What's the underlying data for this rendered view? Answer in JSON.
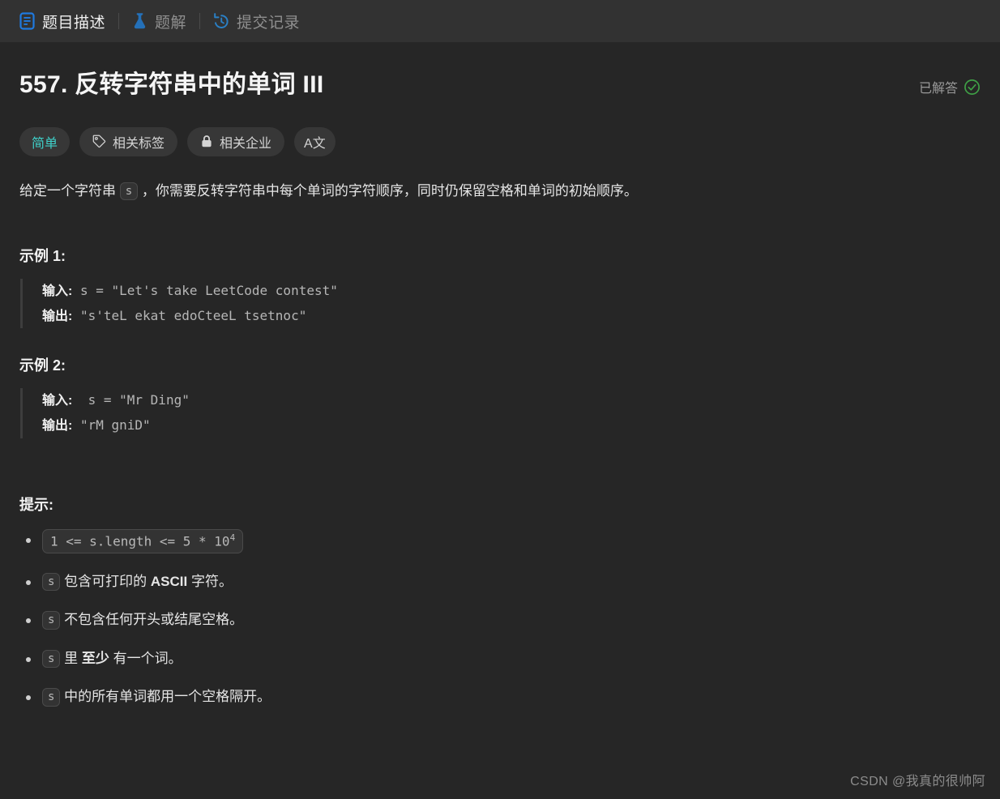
{
  "tabs": [
    {
      "id": "description",
      "label": "题目描述",
      "icon": "document-icon",
      "active": true
    },
    {
      "id": "solution",
      "label": "题解",
      "icon": "flask-icon",
      "active": false
    },
    {
      "id": "submissions",
      "label": "提交记录",
      "icon": "history-icon",
      "active": false
    }
  ],
  "question": {
    "title": "557. 反转字符串中的单词 III",
    "status_label": "已解答",
    "status_icon": "check-circle-icon",
    "status_color": "#3fa046"
  },
  "badges": [
    {
      "id": "difficulty",
      "label": "简单",
      "icon": null,
      "color": "#3fd0c9"
    },
    {
      "id": "tags",
      "label": "相关标签",
      "icon": "tag-icon"
    },
    {
      "id": "companies",
      "label": "相关企业",
      "icon": "lock-icon"
    },
    {
      "id": "translate",
      "label": "A文",
      "icon": "translate-icon"
    }
  ],
  "description": {
    "before": "给定一个字符串 ",
    "code": "s",
    "after": " ，你需要反转字符串中每个单词的字符顺序，同时仍保留空格和单词的初始顺序。"
  },
  "examples": [
    {
      "heading": "示例 1:",
      "input_label": "输入:",
      "input_value": " s = \"Let's take LeetCode contest\"",
      "output_label": "输出:",
      "output_value": " \"s'teL ekat edoCteeL tsetnoc\""
    },
    {
      "heading": "示例 2:",
      "input_label": "输入:",
      "input_value": "  s = \"Mr Ding\"",
      "output_label": "输出:",
      "output_value": " \"rM gniD\""
    }
  ],
  "hints": {
    "heading": "提示:",
    "items": [
      {
        "kind": "code",
        "code_pre": "1 <= s.length <= 5 * 10",
        "code_sup": "4"
      },
      {
        "kind": "chip-text",
        "chip": "s",
        "text_before": " 包含可打印的 ",
        "strong": "ASCII",
        "text_after": " 字符。"
      },
      {
        "kind": "chip-text",
        "chip": "s",
        "text_before": " 不包含任何开头或结尾空格。",
        "strong": "",
        "text_after": ""
      },
      {
        "kind": "chip-text",
        "chip": "s",
        "text_before": " 里 ",
        "strong": "至少",
        "text_after": " 有一个词。"
      },
      {
        "kind": "chip-text",
        "chip": "s",
        "text_before": " 中的所有单词都用一个空格隔开。",
        "strong": "",
        "text_after": ""
      }
    ]
  },
  "watermark": "CSDN @我真的很帅阿"
}
